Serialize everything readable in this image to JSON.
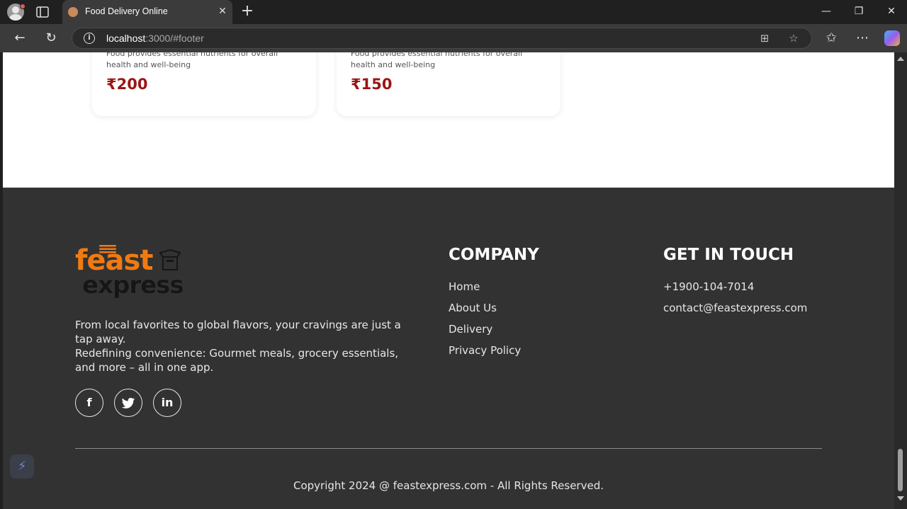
{
  "browser": {
    "tab_title": "Food Delivery Online",
    "url_host": "localhost",
    "url_path": ":3000/#footer"
  },
  "cards": [
    {
      "description": "Food provides essential nutrients for overall health and well-being",
      "price": "₹200"
    },
    {
      "description": "Food provides essential nutrients for overall health and well-being",
      "price": "₹150"
    }
  ],
  "footer": {
    "logo_top": "feast",
    "logo_bottom": "express",
    "about_line1": "From local favorites to global flavors, your cravings are just a tap away.",
    "about_line2": "Redefining convenience: Gourmet meals, grocery essentials, and more – all in one app.",
    "social": [
      {
        "icon": "facebook-icon",
        "glyph": "f"
      },
      {
        "icon": "twitter-icon",
        "glyph": "🐦"
      },
      {
        "icon": "linkedin-icon",
        "glyph": "in"
      }
    ],
    "company_title": "COMPANY",
    "company_links": [
      "Home",
      "About Us",
      "Delivery",
      "Privacy Policy"
    ],
    "contact_title": "GET IN TOUCH",
    "phone": "+1900-104-7014",
    "email": "contact@feastexpress.com",
    "copyright": "Copyright 2024 @ feastexpress.com - All Rights Reserved."
  },
  "colors": {
    "brand_orange": "#f07a12",
    "price_red": "#9b1515",
    "footer_bg": "#323232"
  }
}
